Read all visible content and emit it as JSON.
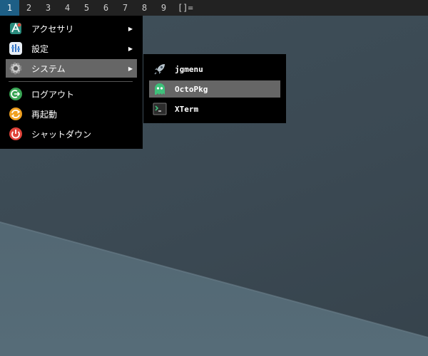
{
  "taskbar": {
    "workspaces": [
      "1",
      "2",
      "3",
      "4",
      "5",
      "6",
      "7",
      "8",
      "9"
    ],
    "layout": "[]="
  },
  "main_menu": {
    "items": [
      {
        "label": "アクセサリ",
        "icon": "accessories-icon",
        "submenu": "▶"
      },
      {
        "label": "設定",
        "icon": "settings-icon",
        "submenu": "▶"
      },
      {
        "label": "システム",
        "icon": "system-gear-icon",
        "submenu": "▶"
      },
      {
        "label": "ログアウト",
        "icon": "logout-icon"
      },
      {
        "label": "再起動",
        "icon": "reboot-icon"
      },
      {
        "label": "シャットダウン",
        "icon": "shutdown-icon"
      }
    ]
  },
  "system_submenu": {
    "items": [
      {
        "label": "jgmenu",
        "icon": "rocket-icon"
      },
      {
        "label": "OctoPkg",
        "icon": "octopus-icon"
      },
      {
        "label": "XTerm",
        "icon": "terminal-icon"
      }
    ]
  },
  "colors": {
    "active_workspace": "#1e5f86",
    "highlight": "#666666",
    "menu_bg": "#000000",
    "desktop": "#3f4d57"
  }
}
